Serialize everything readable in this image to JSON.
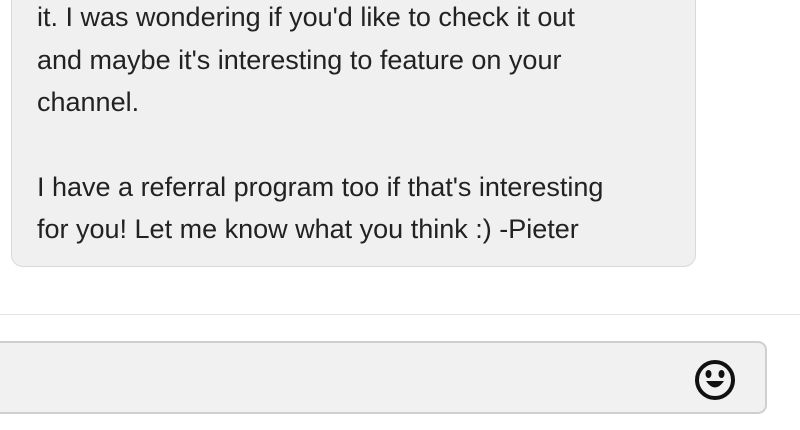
{
  "message": {
    "lines": [
      "it. I was wondering if you'd like to check it out",
      "and maybe it's interesting to feature on your",
      "channel.",
      "",
      "I have a referral program too if that's interesting",
      "for you! Let me know what you think :) -Pieter"
    ]
  },
  "composer": {
    "value": "",
    "emoji_icon": "emoji-smiley-icon"
  }
}
